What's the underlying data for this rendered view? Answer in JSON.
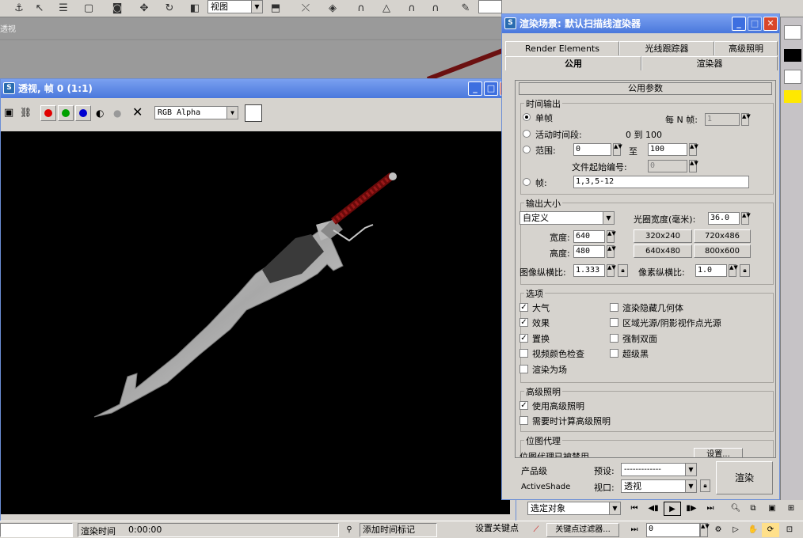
{
  "main_toolbar": {
    "view_select": "视图",
    "icons": [
      "select-icon",
      "select-by-name-icon",
      "rect-region-icon",
      "window-crossing-icon",
      "move-icon",
      "rotate-icon",
      "scale-icon",
      "ref-coord-icon",
      "snap-icon",
      "angle-snap-icon",
      "percent-snap-icon",
      "spinner-snap-icon",
      "abc-icon",
      "mirror-icon",
      "align-icon",
      "layer-icon",
      "curve-editor-icon",
      "schematic-icon",
      "material-editor-icon",
      "render-scene-icon",
      "quick-render-icon"
    ]
  },
  "viewport": {
    "label": "透视"
  },
  "vfb": {
    "title": "透视, 帧 0 (1:1)",
    "channel_select": "RGB Alpha",
    "colors": {
      "red": "#e00000",
      "green": "#00a000",
      "blue": "#0000d0"
    }
  },
  "render_dialog": {
    "title": "渲染场景: 默认扫描线渲染器",
    "tabs_row1": [
      "Render Elements",
      "光线跟踪器",
      "高级照明"
    ],
    "tabs_row2": [
      "公用",
      "渲染器"
    ],
    "rollout": "公用参数",
    "time_output": {
      "title": "时间输出",
      "single": "单帧",
      "every_n_label": "每 N 帧:",
      "every_n_value": "1",
      "active_segment": "活动时间段:",
      "active_range": "0 到 100",
      "range": "范围:",
      "range_from": "0",
      "range_to_label": "至",
      "range_to": "100",
      "file_start_label": "文件起始编号:",
      "file_start": "0",
      "frames": "帧:",
      "frames_value": "1,3,5-12"
    },
    "output_size": {
      "title": "输出大小",
      "preset": "自定义",
      "aperture_label": "光圈宽度(毫米):",
      "aperture": "36.0",
      "width_label": "宽度:",
      "width": "640",
      "height_label": "高度:",
      "height": "480",
      "presets": [
        "320x240",
        "720x486",
        "640x480",
        "800x600"
      ],
      "aspect_label": "图像纵横比:",
      "aspect": "1.333",
      "pixel_aspect_label": "像素纵横比:",
      "pixel_aspect": "1.0"
    },
    "options": {
      "title": "选项",
      "left": [
        {
          "label": "大气",
          "checked": true
        },
        {
          "label": "效果",
          "checked": true
        },
        {
          "label": "置换",
          "checked": true
        },
        {
          "label": "视频颜色检查",
          "checked": false
        },
        {
          "label": "渲染为场",
          "checked": false
        }
      ],
      "right": [
        {
          "label": "渲染隐藏几何体",
          "checked": false
        },
        {
          "label": "区域光源/阴影视作点光源",
          "checked": false
        },
        {
          "label": "强制双面",
          "checked": false
        },
        {
          "label": "超级黑",
          "checked": false
        }
      ]
    },
    "adv_lighting": {
      "title": "高级照明",
      "use": "使用高级照明",
      "compute": "需要时计算高级照明"
    },
    "bitmap_proxy": {
      "title": "位图代理",
      "status": "位图代理已被禁用",
      "setup_button": "设置..."
    },
    "bottom": {
      "product_label": "产品级",
      "preset_label": "预设:",
      "preset_value": "-------------",
      "activeshade_label": "ActiveShade",
      "viewport_label": "视口:",
      "viewport_value": "透视",
      "render_button": "渲染"
    }
  },
  "bottom_controls": {
    "selection": "选定对象",
    "frame": "0"
  },
  "status_bar": {
    "render_time_label": "渲染时间",
    "render_time": "0:00:00",
    "add_time_tag": "添加时间标记",
    "set_key": "设置关键点",
    "key_filters": "关键点过滤器..."
  }
}
